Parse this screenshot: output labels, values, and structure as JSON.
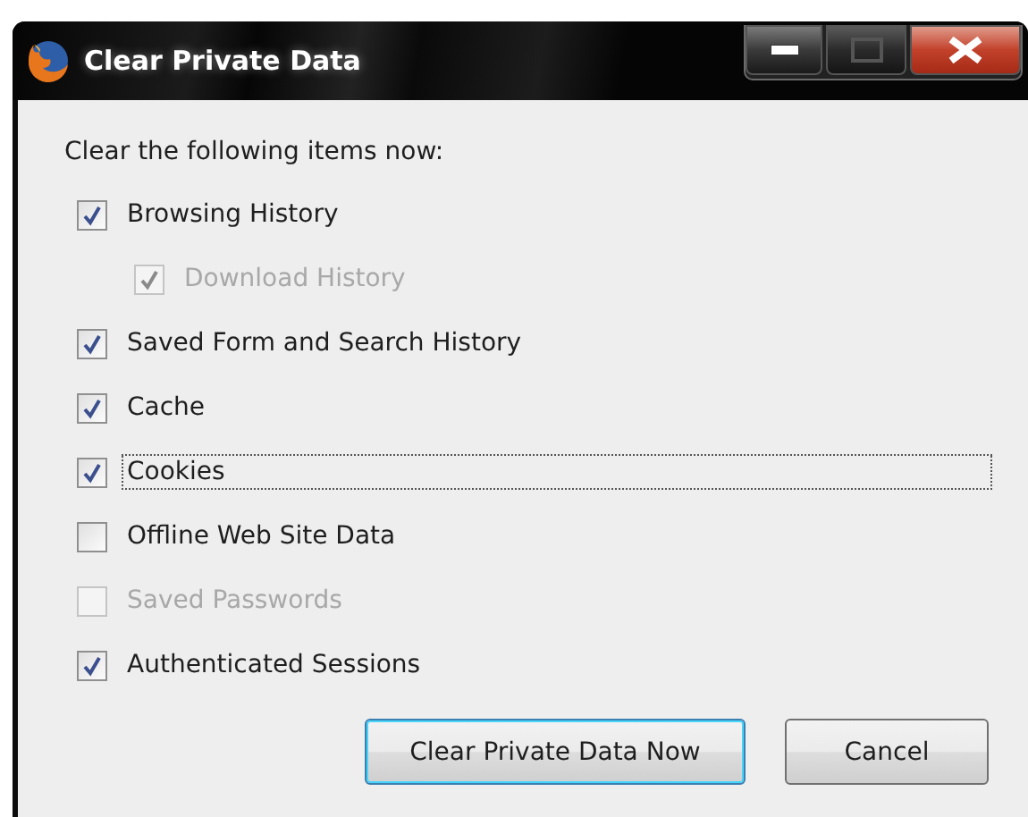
{
  "window": {
    "title": "Clear Private Data"
  },
  "heading": "Clear the following items now:",
  "items": [
    {
      "label": "Browsing History",
      "checked": true,
      "disabled": false,
      "focused": false,
      "children": [
        {
          "label": "Download History",
          "checked": true,
          "disabled": true,
          "focused": false
        }
      ]
    },
    {
      "label": "Saved Form and Search History",
      "checked": true,
      "disabled": false,
      "focused": false
    },
    {
      "label": "Cache",
      "checked": true,
      "disabled": false,
      "focused": false
    },
    {
      "label": "Cookies",
      "checked": true,
      "disabled": false,
      "focused": true
    },
    {
      "label": "Offline Web Site Data",
      "checked": false,
      "disabled": false,
      "focused": false
    },
    {
      "label": "Saved Passwords",
      "checked": false,
      "disabled": true,
      "focused": false
    },
    {
      "label": "Authenticated Sessions",
      "checked": true,
      "disabled": false,
      "focused": false
    }
  ],
  "buttons": [
    {
      "label": "Clear Private Data Now",
      "default": true
    },
    {
      "label": "Cancel",
      "default": false
    }
  ]
}
